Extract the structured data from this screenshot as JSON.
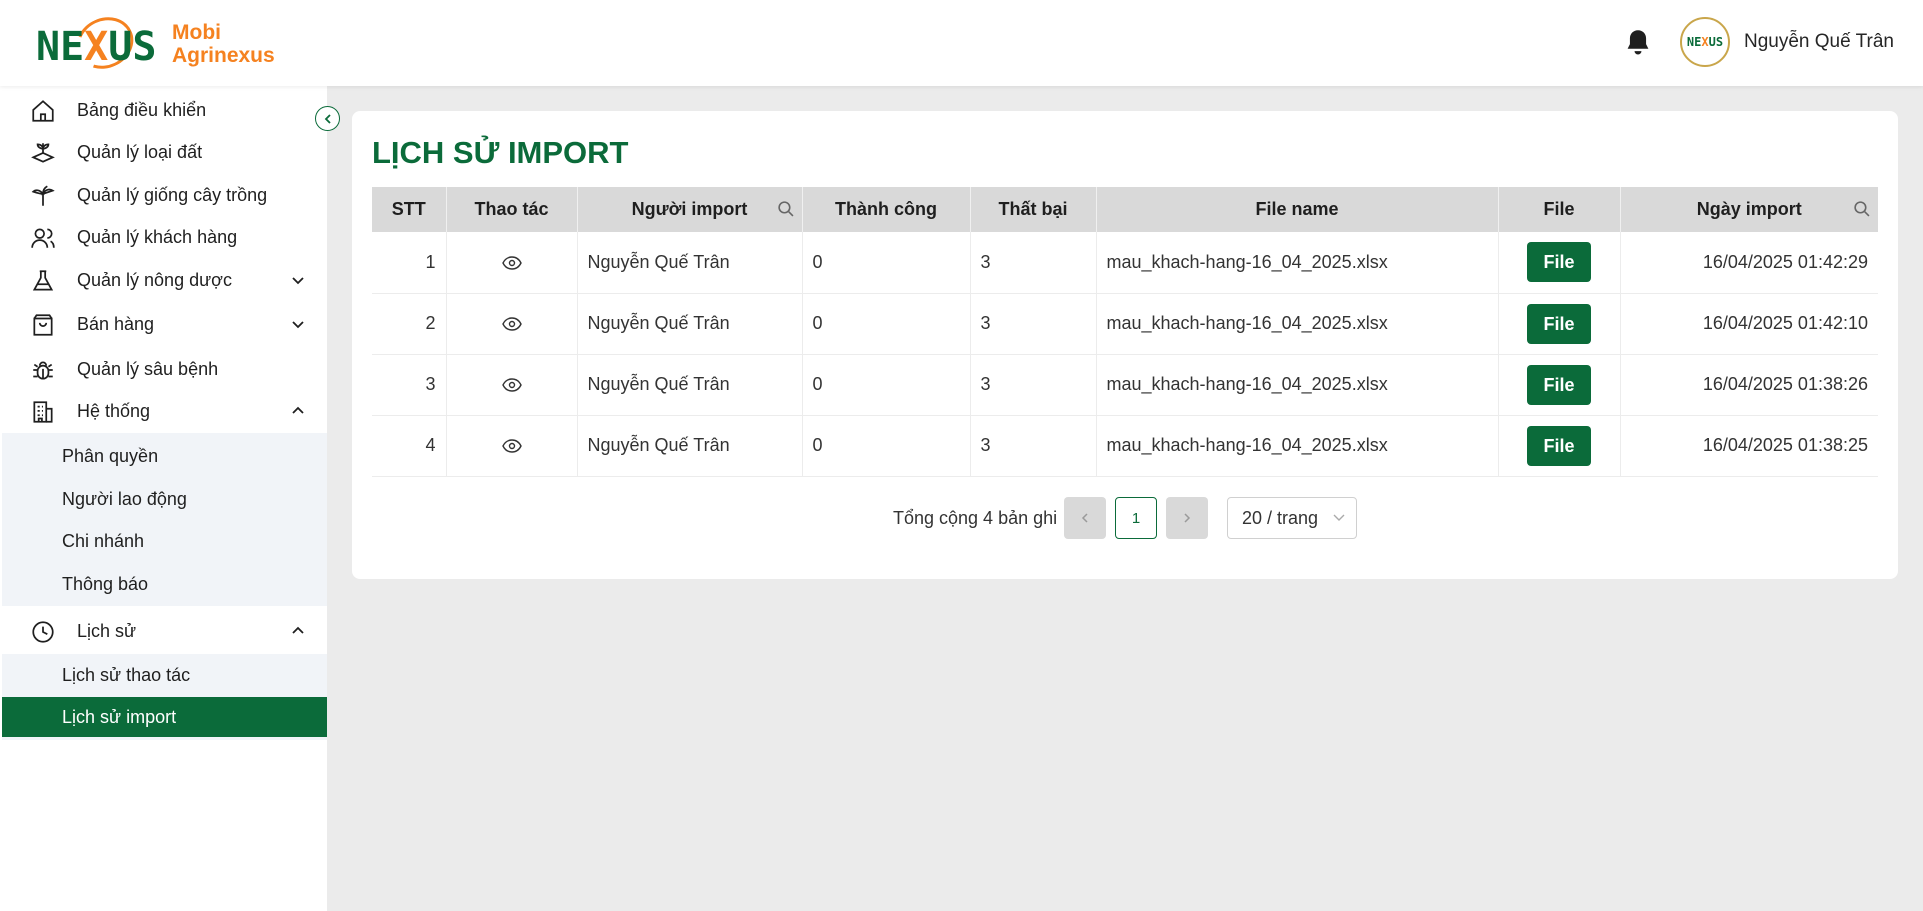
{
  "brand": {
    "name": "Mobi Agrinexus",
    "line1": "Mobi",
    "line2": "Agrinexus",
    "mark_pre": "NE",
    "mark_x": "X",
    "mark_post": "US",
    "primary_color": "#0b6b3a",
    "accent_color": "#f58220"
  },
  "header": {
    "user_name": "Nguyễn Quế Trân",
    "avatar_pre": "NE",
    "avatar_x": "X",
    "avatar_post": "US"
  },
  "sidebar": {
    "items": [
      {
        "label": "Bảng điều khiển",
        "icon": "home-icon"
      },
      {
        "label": "Quản lý loại đất",
        "icon": "soil-icon"
      },
      {
        "label": "Quản lý giống cây trồng",
        "icon": "plant-icon"
      },
      {
        "label": "Quản lý khách hàng",
        "icon": "users-icon"
      },
      {
        "label": "Quản lý nông dược",
        "icon": "flask-icon"
      },
      {
        "label": "Bán hàng",
        "icon": "shopping-bag-icon"
      },
      {
        "label": "Quản lý sâu bệnh",
        "icon": "bug-icon"
      },
      {
        "label": "Hệ thống",
        "icon": "building-icon"
      },
      {
        "label": "Lịch sử",
        "icon": "clock-icon"
      }
    ],
    "system_sub": [
      "Phân quyền",
      "Người lao động",
      "Chi nhánh",
      "Thông báo"
    ],
    "history_sub": [
      "Lịch sử thao tác",
      "Lịch sử import"
    ]
  },
  "page": {
    "title": "LỊCH SỬ IMPORT"
  },
  "table": {
    "columns": [
      "STT",
      "Thao tác",
      "Người import",
      "Thành công",
      "Thất bại",
      "File name",
      "File",
      "Ngày import"
    ],
    "file_button_label": "File",
    "rows": [
      {
        "stt": "1",
        "user": "Nguyễn Quế Trân",
        "success": "0",
        "failed": "3",
        "file_name": "mau_khach-hang-16_04_2025.xlsx",
        "date": "16/04/2025 01:42:29"
      },
      {
        "stt": "2",
        "user": "Nguyễn Quế Trân",
        "success": "0",
        "failed": "3",
        "file_name": "mau_khach-hang-16_04_2025.xlsx",
        "date": "16/04/2025 01:42:10"
      },
      {
        "stt": "3",
        "user": "Nguyễn Quế Trân",
        "success": "0",
        "failed": "3",
        "file_name": "mau_khach-hang-16_04_2025.xlsx",
        "date": "16/04/2025 01:38:26"
      },
      {
        "stt": "4",
        "user": "Nguyễn Quế Trân",
        "success": "0",
        "failed": "3",
        "file_name": "mau_khach-hang-16_04_2025.xlsx",
        "date": "16/04/2025 01:38:25"
      }
    ]
  },
  "pagination": {
    "total_text": "Tổng cộng 4 bản ghi",
    "current_page": "1",
    "page_size": "20 / trang"
  }
}
